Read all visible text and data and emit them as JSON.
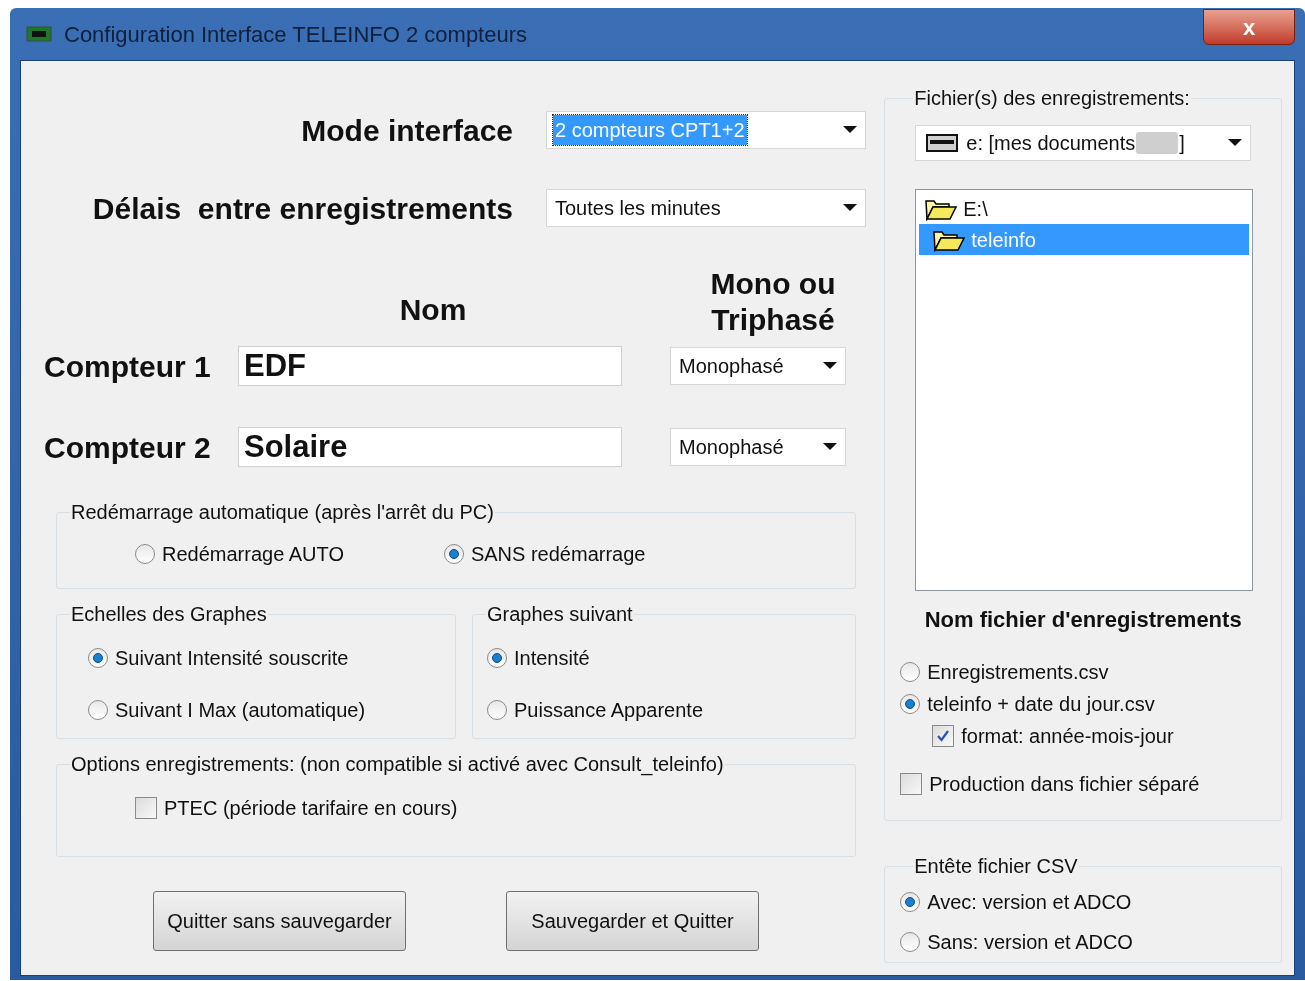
{
  "window": {
    "title": "Configuration Interface TELEINFO 2 compteurs",
    "close": "x"
  },
  "mode_interface": {
    "label": "Mode interface",
    "value": "2 compteurs CPT1+2",
    "highlighted": true
  },
  "delais": {
    "label": "Délais  entre enregistrements",
    "value": "Toutes les minutes",
    "highlighted": false
  },
  "headers": {
    "nom": "Nom",
    "phase": "Mono ou Triphasé"
  },
  "compteurs": [
    {
      "label": "Compteur 1",
      "name": "EDF",
      "phase": "Monophasé"
    },
    {
      "label": "Compteur 2",
      "name": "Solaire",
      "phase": "Monophasé"
    }
  ],
  "redemarrage": {
    "title": "Redémarrage automatique (après l'arrêt du PC)",
    "options": [
      {
        "label": "Redémarrage AUTO",
        "selected": false
      },
      {
        "label": "SANS redémarrage",
        "selected": true
      }
    ]
  },
  "echelles": {
    "title": "Echelles des Graphes",
    "options": [
      {
        "label": "Suivant Intensité souscrite",
        "selected": true
      },
      {
        "label": "Suivant I Max (automatique)",
        "selected": false
      }
    ]
  },
  "graphes": {
    "title": "Graphes suivant",
    "options": [
      {
        "label": "Intensité",
        "selected": true
      },
      {
        "label": "Puissance Apparente",
        "selected": false
      }
    ]
  },
  "options_enregistrements": {
    "title": "Options enregistrements: (non compatible si activé avec Consult_teleinfo)",
    "checkboxes": [
      {
        "label": "PTEC (période tarifaire en cours)",
        "checked": false
      }
    ]
  },
  "buttons": [
    "Quitter sans sauvegarder",
    "Sauvegarder et Quitter"
  ],
  "fichiers": {
    "title": "Fichier(s) des enregistrements:",
    "drive": "e: [mes documents",
    "drive_end": "]",
    "folders": [
      {
        "label": "E:\\",
        "selected": false,
        "children": [
          {
            "label": "teleinfo",
            "selected": true
          }
        ]
      }
    ],
    "file_name_title": "Nom fichier d'enregistrements",
    "items": [
      {
        "kind": "radio",
        "label": "Enregistrements.csv",
        "selected": false
      },
      {
        "kind": "radio",
        "label": "teleinfo + date du jour.csv",
        "selected": true,
        "children": [
          {
            "kind": "checkbox",
            "label": "format: année-mois-jour",
            "checked": true
          }
        ]
      },
      {
        "kind": "checkbox",
        "label": "Production dans fichier séparé",
        "checked": false
      }
    ]
  },
  "entete": {
    "title": "Entête fichier CSV",
    "options": [
      {
        "label": "Avec: version et ADCO",
        "selected": true
      },
      {
        "label": "Sans: version et ADCO",
        "selected": false
      }
    ]
  }
}
